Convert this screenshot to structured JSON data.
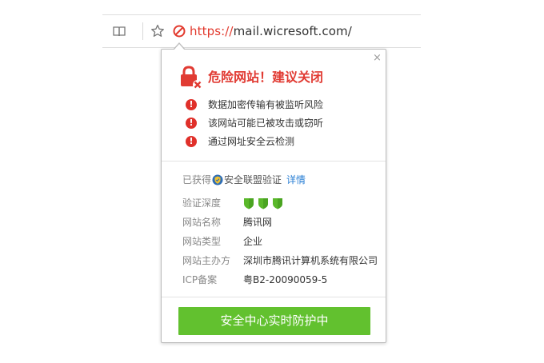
{
  "address_bar": {
    "url_scheme": "https://",
    "url_rest": "mail.wicresoft.com/",
    "icons": [
      "reader-view-icon",
      "bookmark-star-icon",
      "danger-no-entry-icon"
    ],
    "danger_color": "#e23a2e"
  },
  "popup": {
    "close_label": "×",
    "title": "危险网站！建议关闭",
    "title_color": "#e13b33",
    "warnings": [
      "数据加密传输有被监听风险",
      "该网站可能已被攻击或窃听",
      "通过网址安全云检测"
    ],
    "warning_mark": "!",
    "warning_color": "#e0302a",
    "cert": {
      "prefix": "已获得",
      "label": "安全联盟验证",
      "detail_link": "详情",
      "link_color": "#2a7fd4"
    },
    "info": {
      "depth_label": "验证深度",
      "depth_level": 3,
      "depth_color": "#5ab82a",
      "rows": [
        {
          "key": "网站名称",
          "value": "腾讯网"
        },
        {
          "key": "网站类型",
          "value": "企业"
        },
        {
          "key": "网站主办方",
          "value": "深圳市腾讯计算机系统有限公司"
        },
        {
          "key": "ICP备案",
          "value": "粤B2-20090059-5"
        }
      ]
    },
    "cta_label": "安全中心实时防护中",
    "cta_color": "#62c12f"
  }
}
